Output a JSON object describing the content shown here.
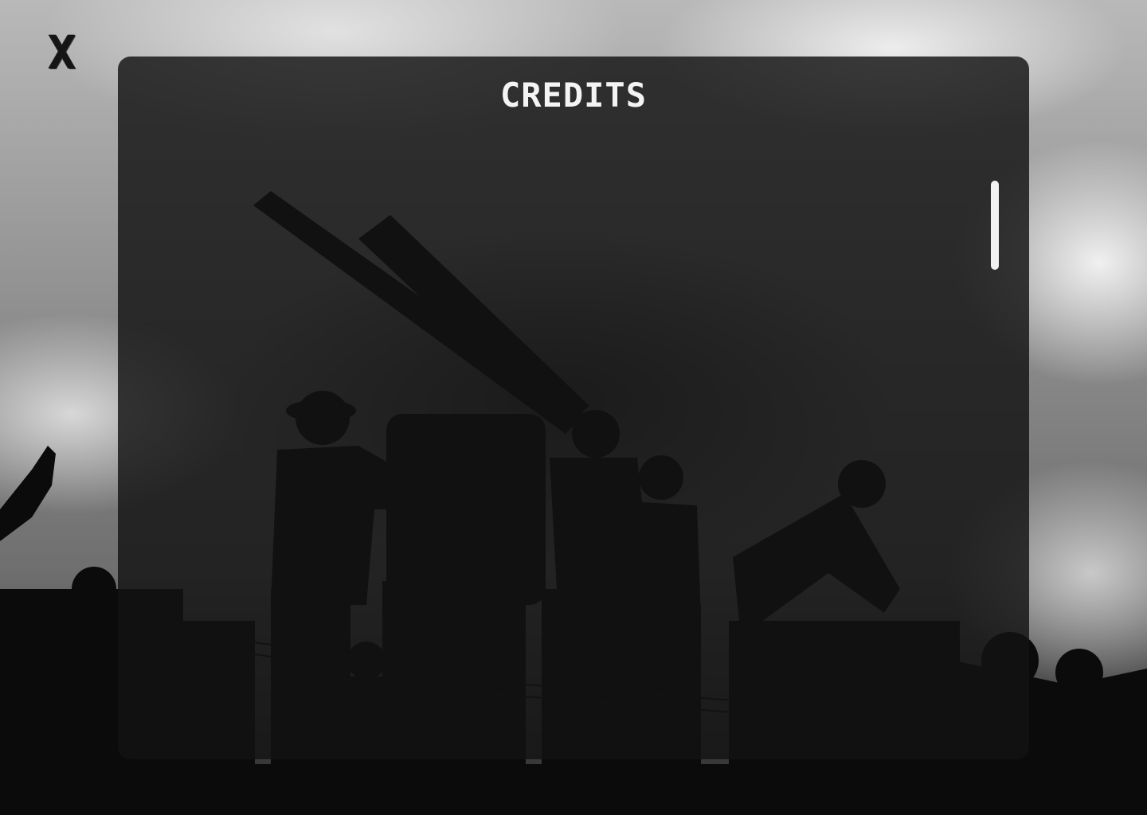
{
  "screen": {
    "title": "CREDITS",
    "close_label": "X"
  },
  "icons": {
    "close": "close-icon"
  },
  "colors": {
    "panel_bg": "#121212",
    "title_text": "#f4f4f4",
    "scrollbar": "#f2f2f2",
    "close_text": "#151515"
  }
}
